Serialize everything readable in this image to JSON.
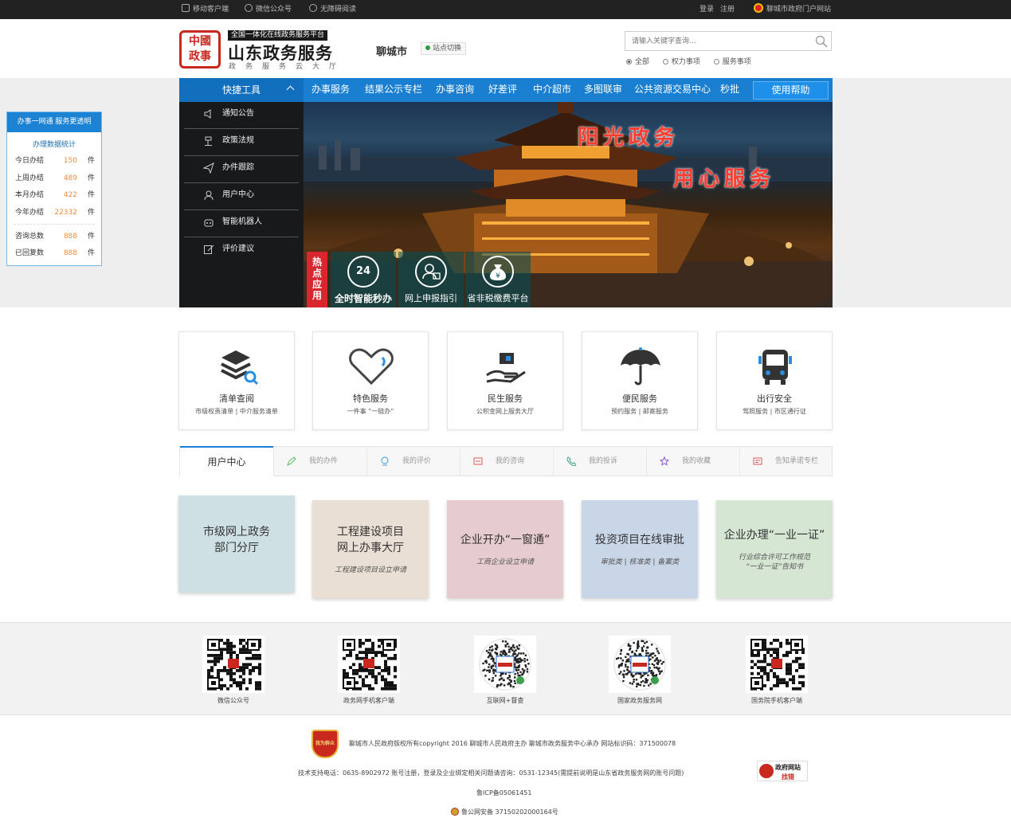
{
  "topbar": {
    "mobile": "移动客户端",
    "wechat": "微信公众号",
    "accessible": "无障碍阅读",
    "login": "登录",
    "register": "注册",
    "portal": "聊城市政府门户网站"
  },
  "header": {
    "seal_text": "中國\n政事",
    "platform_tag": "全国一体化在线政务服务平台",
    "title": "山东政务服务",
    "subtitle": "政务服务云大厅",
    "city": "聊城市",
    "site_switch": "站点切换",
    "search_placeholder": "请输入关键字查询...",
    "search_options": [
      "全部",
      "权力事项",
      "服务事项"
    ]
  },
  "nav": {
    "quick": "快捷工具",
    "items": [
      "办事服务",
      "结果公示专栏",
      "办事咨询",
      "好差评",
      "中介超市",
      "多图联审",
      "公共资源交易中心",
      "秒批"
    ],
    "help": "使用帮助"
  },
  "side_menu": [
    "通知公告",
    "政策法规",
    "办件跟踪",
    "用户中心",
    "智能机器人",
    "评价建议"
  ],
  "banner": {
    "slogan1": "阳光政务",
    "slogan2": "用心服务",
    "hot_label": "热点应用",
    "hot_apps": [
      "全时智能秒办",
      "网上申报指引",
      "省非税缴费平台"
    ],
    "badge24": "24"
  },
  "float_panel": {
    "title": "办事一网通 服务更透明",
    "subtitle": "办理数据统计",
    "rows": [
      {
        "label": "今日办结",
        "value": "150",
        "unit": "件"
      },
      {
        "label": "上周办结",
        "value": "489",
        "unit": "件"
      },
      {
        "label": "本月办结",
        "value": "422",
        "unit": "件"
      },
      {
        "label": "今年办结",
        "value": "22332",
        "unit": "件"
      },
      {
        "label": "咨询总数",
        "value": "888",
        "unit": "件"
      },
      {
        "label": "已回复数",
        "value": "888",
        "unit": "件"
      }
    ]
  },
  "cards": [
    {
      "title": "清单查阅",
      "sub": "市级权责清单 | 中介服务清单"
    },
    {
      "title": "特色服务",
      "sub": "一件事 “一链办”"
    },
    {
      "title": "民生服务",
      "sub": "公积金网上服务大厅"
    },
    {
      "title": "便民服务",
      "sub": "预约服务 | 邮寄服务"
    },
    {
      "title": "出行安全",
      "sub": "驾照服务 | 市区通行证"
    }
  ],
  "user_tabs": {
    "active": "用户中心",
    "items": [
      "我的办件",
      "我的评价",
      "我的咨询",
      "我的投诉",
      "我的收藏",
      "告知承诺专栏"
    ]
  },
  "tiles": [
    {
      "title": "市级网上政务\n部门分厅",
      "sub": "",
      "bg": "#cfe0e4"
    },
    {
      "title": "工程建设项目\n网上办事大厅",
      "sub": "工程建设项目设立申请",
      "bg": "#eadfd4"
    },
    {
      "title": "企业开办“一窗通”",
      "sub": "工商企业设立申请",
      "bg": "#e7cccf"
    },
    {
      "title": "投资项目在线审批",
      "sub": "审批类 | 核准类 | 备案类",
      "bg": "#c9d6e8"
    },
    {
      "title": "企业办理“一业一证”",
      "sub": "行业综合许可工作规范\n“一业一证”告知书",
      "bg": "#d5e6d3"
    }
  ],
  "qrcodes": [
    "微信公众号",
    "政务网手机客户端",
    "互联网+督查",
    "国家政务服务网",
    "国务院手机客户端"
  ],
  "footer": {
    "emblem": "我为群众",
    "line1": "聊城市人民政府版权所有copyright 2016   聊城市人民政府主办  聊城市政务服务中心承办   网站标识码：371500078",
    "line2": "技术支持电话：0635-8902972    账号注册，登录及企业绑定相关问题请咨询：0531-12345(需提前说明是山东省政务服务网的账号问题)",
    "icp": "鲁ICP备05061451",
    "police": "鲁公网安备 37150202000164号",
    "gov_find_1": "政府网站",
    "gov_find_2": "找错"
  },
  "colors": {
    "nav_blue": "#1a7fd0",
    "accent_red": "#d9262f",
    "stat_orange": "#f08a3c"
  }
}
